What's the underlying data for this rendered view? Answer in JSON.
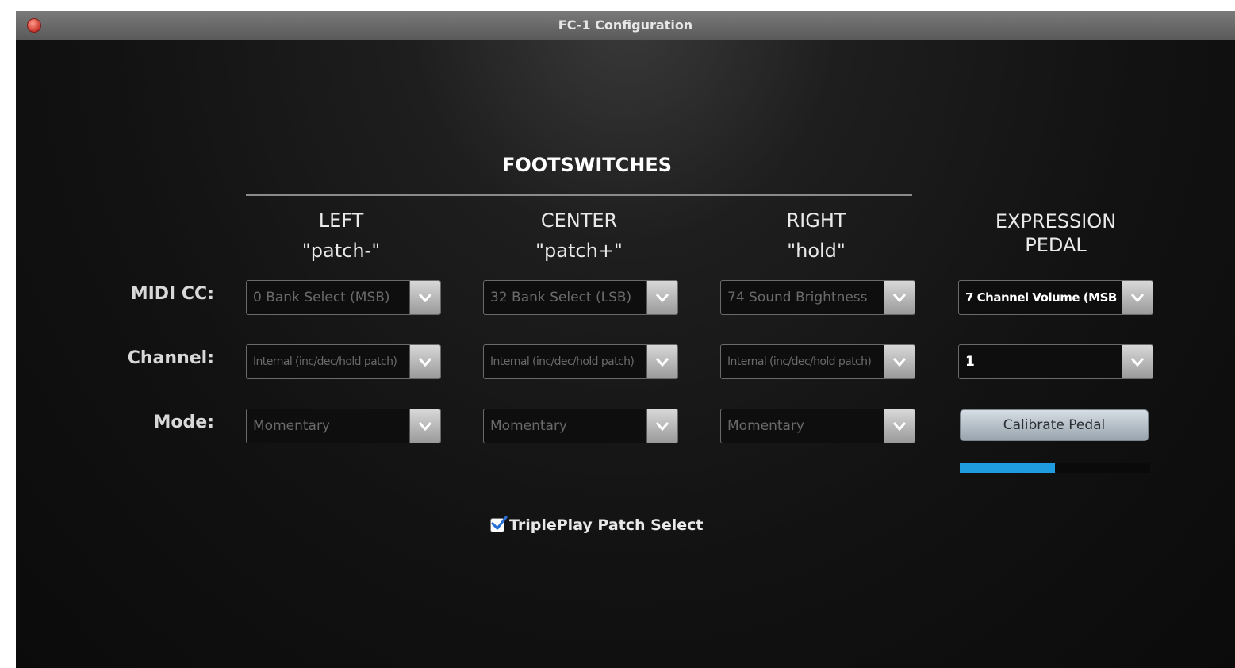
{
  "window": {
    "title": "FC-1 Configuration"
  },
  "footswitches": {
    "heading": "FOOTSWITCHES",
    "columns": [
      {
        "name": "LEFT",
        "function": "\"patch-\""
      },
      {
        "name": "CENTER",
        "function": "\"patch+\""
      },
      {
        "name": "RIGHT",
        "function": "\"hold\""
      }
    ]
  },
  "expression_pedal": {
    "heading_line1": "EXPRESSION",
    "heading_line2": "PEDAL"
  },
  "row_labels": {
    "midi_cc": "MIDI CC:",
    "channel": "Channel:",
    "mode": "Mode:"
  },
  "midi_cc": [
    "0 Bank Select (MSB)",
    "32 Bank Select (LSB)",
    "74 Sound Brightness",
    "7 Channel Volume (MSB)"
  ],
  "channel": [
    "Internal (inc/dec/hold patch)",
    "Internal (inc/dec/hold patch)",
    "Internal (inc/dec/hold patch)",
    "1"
  ],
  "mode": [
    "Momentary",
    "Momentary",
    "Momentary"
  ],
  "calibrate_button": "Calibrate Pedal",
  "pedal_level_fraction": 0.5,
  "tripleplay": {
    "label": "TriplePlay Patch Select",
    "checked": true
  },
  "colors": {
    "progress": "#1f9be0",
    "checkbox_check": "#2a6fd6",
    "close_button": "#c9362c"
  },
  "icons": {
    "close": "close-icon",
    "dropdown": "chevron-down-icon",
    "check": "checkmark-icon"
  }
}
